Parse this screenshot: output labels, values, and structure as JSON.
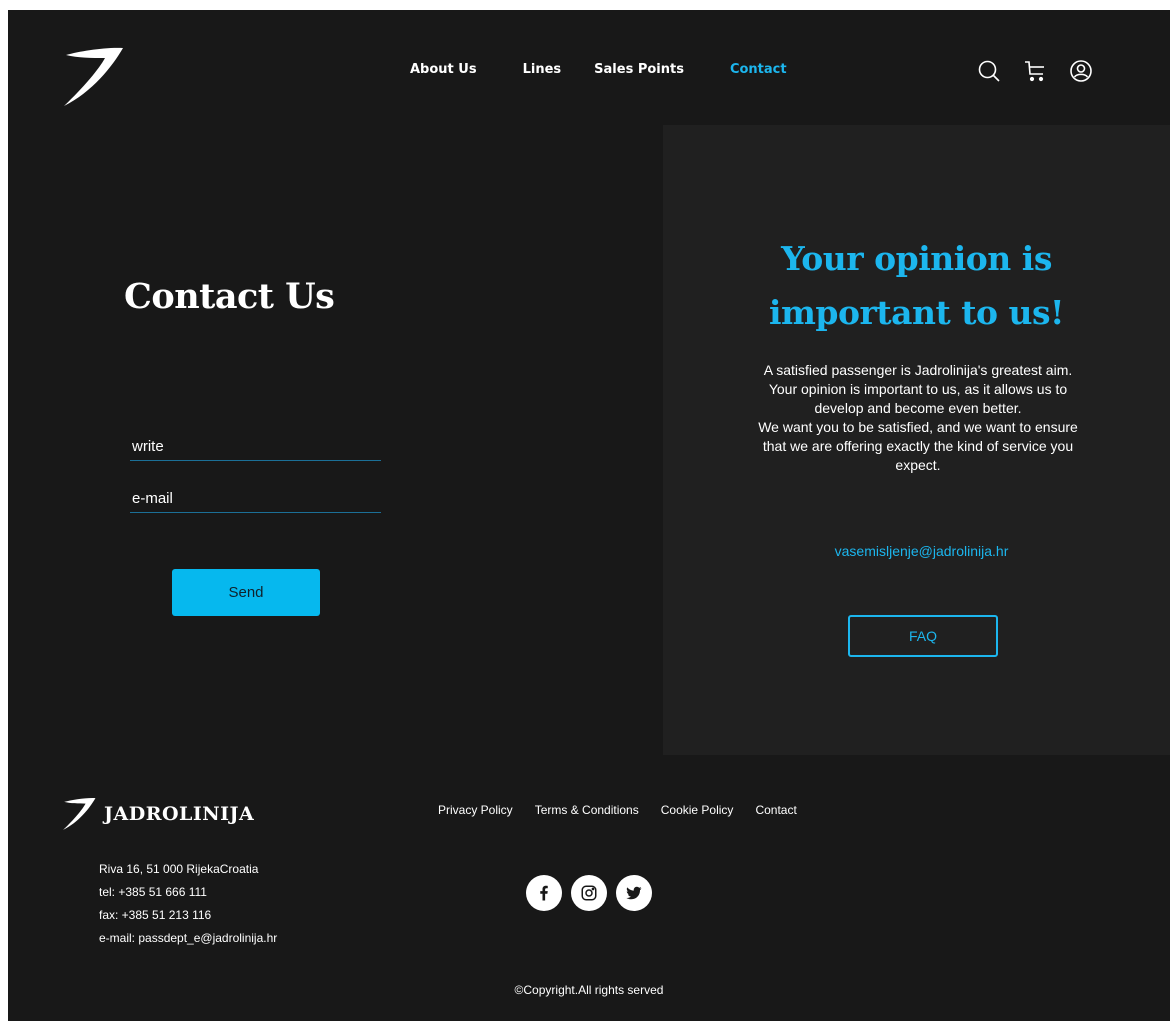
{
  "nav": {
    "items": [
      {
        "label": "About Us"
      },
      {
        "label": "Lines"
      },
      {
        "label": "Sales Points"
      },
      {
        "label": "Contact"
      }
    ],
    "active_color": "#1cb6ee"
  },
  "header_icons": [
    "search-icon",
    "cart-icon",
    "user-icon"
  ],
  "contact": {
    "title": "Contact Us",
    "fields": [
      {
        "placeholder": "write"
      },
      {
        "placeholder": "e-mail"
      }
    ],
    "send_label": "Send"
  },
  "opinion": {
    "title": "Your opinion is important to us!",
    "text_lines": [
      "A satisfied passenger is Jadrolinija's greatest aim.",
      "Your opinion is important to us, as it allows us to",
      "develop and become even better.",
      "We want you to be satisfied, and we want to ensure",
      "that we are offering exactly the kind of service you",
      "expect."
    ],
    "email": "vasemisljenje@jadrolinija.hr",
    "faq_label": "FAQ"
  },
  "footer": {
    "brand": "JADROLINIJA",
    "address": [
      "Riva 16, 51 000 RijekaCroatia",
      "tel: +385 51 666 111",
      "fax: +385 51 213 116",
      "e-mail: passdept_e@jadrolinija.hr"
    ],
    "links": [
      "Privacy Policy",
      "Terms & Conditions",
      "Cookie Policy",
      "Contact"
    ],
    "social": [
      "facebook-icon",
      "instagram-icon",
      "twitter-icon"
    ],
    "copyright": "©Copyright.All rights served"
  },
  "colors": {
    "background": "#181818",
    "panel": "#202020",
    "accent": "#1cb6ee",
    "button": "#06b8ee"
  }
}
